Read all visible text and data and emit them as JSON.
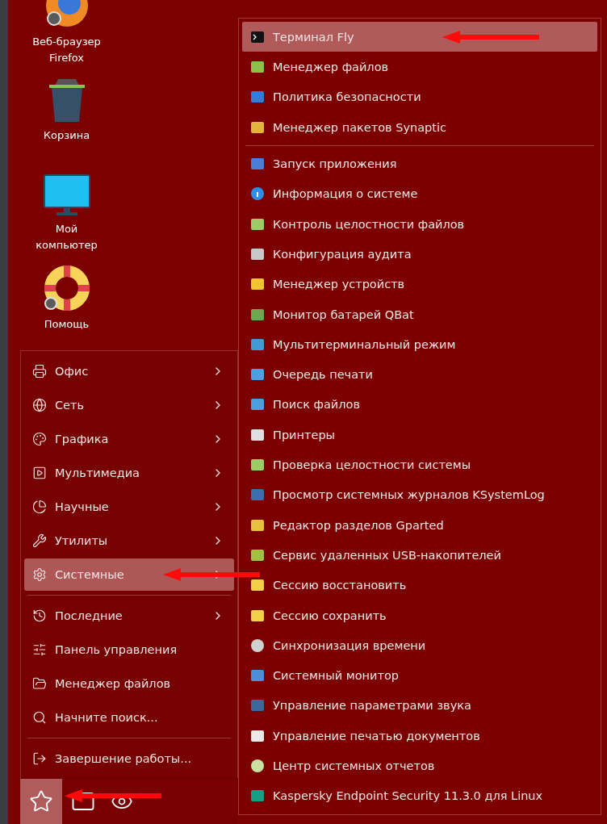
{
  "desktop_icons": [
    {
      "label": "Веб-браузер Firefox"
    },
    {
      "label": "Корзина"
    },
    {
      "label": "Мой компьютер"
    },
    {
      "label": "Помощь"
    }
  ],
  "menu": {
    "groups": [
      [
        {
          "label": "Офис",
          "has_submenu": true,
          "selected": false,
          "pointed": false
        },
        {
          "label": "Сеть",
          "has_submenu": true,
          "selected": false,
          "pointed": false
        },
        {
          "label": "Графика",
          "has_submenu": true,
          "selected": false,
          "pointed": false
        },
        {
          "label": "Мультимедиа",
          "has_submenu": true,
          "selected": false,
          "pointed": false
        },
        {
          "label": "Научные",
          "has_submenu": true,
          "selected": false,
          "pointed": false
        },
        {
          "label": "Утилиты",
          "has_submenu": true,
          "selected": false,
          "pointed": false
        },
        {
          "label": "Системные",
          "has_submenu": true,
          "selected": true,
          "pointed": true
        }
      ],
      [
        {
          "label": "Последние",
          "has_submenu": true,
          "selected": false,
          "pointed": false
        },
        {
          "label": "Панель управления",
          "has_submenu": false,
          "selected": false,
          "pointed": false
        },
        {
          "label": "Менеджер файлов",
          "has_submenu": false,
          "selected": false,
          "pointed": false
        },
        {
          "label": "Начните поиск...",
          "has_submenu": false,
          "selected": false,
          "pointed": false
        }
      ],
      [
        {
          "label": "Завершение работы...",
          "has_submenu": false,
          "selected": false,
          "pointed": false
        }
      ]
    ]
  },
  "taskbar": {
    "start_button": {
      "selected": true,
      "pointed": true
    }
  },
  "submenu": {
    "groups": [
      [
        {
          "label": "Терминал Fly",
          "selected": true,
          "pointed": true
        },
        {
          "label": "Менеджер файлов",
          "selected": false,
          "pointed": false
        },
        {
          "label": "Политика безопасности",
          "selected": false,
          "pointed": false
        },
        {
          "label": "Менеджер пакетов Synaptic",
          "selected": false,
          "pointed": false
        }
      ],
      [
        {
          "label": "Запуск приложения",
          "selected": false,
          "pointed": false
        },
        {
          "label": "Информация о системе",
          "selected": false,
          "pointed": false
        },
        {
          "label": "Контроль целостности файлов",
          "selected": false,
          "pointed": false
        },
        {
          "label": "Конфигурация аудита",
          "selected": false,
          "pointed": false
        },
        {
          "label": "Менеджер устройств",
          "selected": false,
          "pointed": false
        },
        {
          "label": "Монитор батарей QBat",
          "selected": false,
          "pointed": false
        },
        {
          "label": "Мультитерминальный режим",
          "selected": false,
          "pointed": false
        },
        {
          "label": "Очередь печати",
          "selected": false,
          "pointed": false
        },
        {
          "label": "Поиск файлов",
          "selected": false,
          "pointed": false
        },
        {
          "label": "Принтеры",
          "selected": false,
          "pointed": false
        },
        {
          "label": "Проверка целостности системы",
          "selected": false,
          "pointed": false
        },
        {
          "label": "Просмотр системных журналов KSystemLog",
          "selected": false,
          "pointed": false
        },
        {
          "label": "Редактор разделов Gparted",
          "selected": false,
          "pointed": false
        },
        {
          "label": "Сервис удаленных USB-накопителей",
          "selected": false,
          "pointed": false
        },
        {
          "label": "Сессию восстановить",
          "selected": false,
          "pointed": false
        },
        {
          "label": "Сессию сохранить",
          "selected": false,
          "pointed": false
        },
        {
          "label": "Синхронизация времени",
          "selected": false,
          "pointed": false
        },
        {
          "label": "Системный монитор",
          "selected": false,
          "pointed": false
        },
        {
          "label": "Управление параметрами звука",
          "selected": false,
          "pointed": false
        },
        {
          "label": "Управление печатью документов",
          "selected": false,
          "pointed": false
        },
        {
          "label": "Центр системных отчетов",
          "selected": false,
          "pointed": false
        },
        {
          "label": "Kaspersky Endpoint Security 11.3.0 для Linux",
          "selected": false,
          "pointed": false
        }
      ]
    ]
  }
}
